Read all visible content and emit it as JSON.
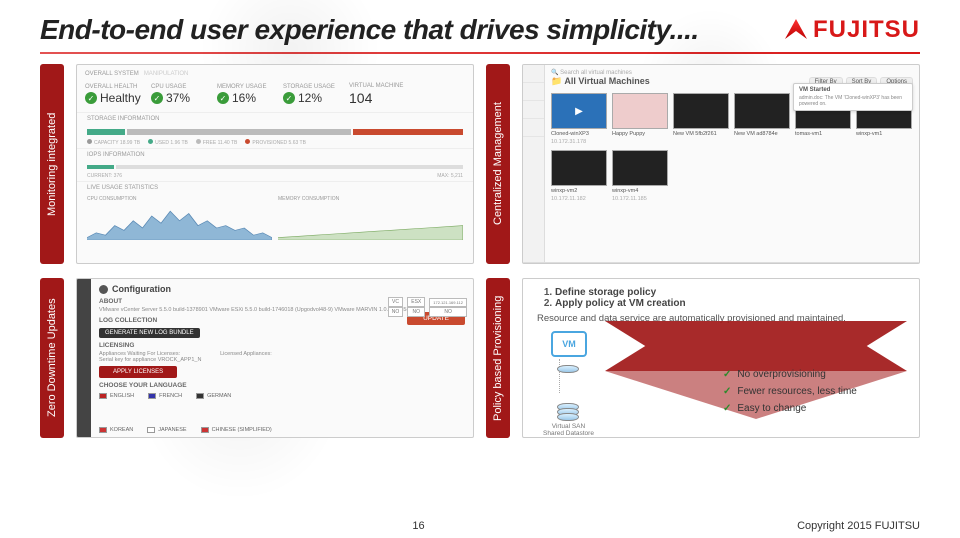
{
  "header": {
    "title": "End-to-end user experience that drives simplicity....",
    "logo_text": "FUJITSU"
  },
  "tabs": {
    "monitoring": "Monitoring integrated",
    "centralized": "Centralized Management",
    "zero_downtime": "Zero Downtime Updates",
    "policy": "Policy based Provisioning"
  },
  "monitoring": {
    "section1": "OVERALL SYSTEM",
    "section1b": "MANIPULATION",
    "health_k": "OVERALL HEALTH",
    "health_v": "Healthy",
    "cpu_k": "CPU USAGE",
    "cpu_v": "37%",
    "mem_k": "MEMORY USAGE",
    "mem_v": "16%",
    "stor_k": "STORAGE USAGE",
    "stor_v": "12%",
    "vm_k": "VIRTUAL MACHINE",
    "vm_v": "104",
    "s_storage": "STORAGE INFORMATION",
    "cap_lbl": "CAPACITY 18.99 TB",
    "used_lbl": "USED 1.96 TB",
    "free_lbl": "FREE 11.40 TB",
    "prov_lbl": "PROVISIONED 5.63 TB",
    "s_iops": "IOPS INFORMATION",
    "current_lbl": "CURRENT: 376",
    "max_lbl": "MAX: 5,211",
    "s_live": "LIVE USAGE STATISTICS",
    "chart1": "CPU CONSUMPTION",
    "chart2": "MEMORY CONSUMPTION"
  },
  "centralized": {
    "search_placeholder": "Search all virtual machines",
    "crumb": "All Virtual Machines",
    "filter": "Filter By",
    "sort": "Sort By",
    "opt": "Options",
    "popup_title": "VM Started",
    "popup_line": "admin.doc: The VM 'Cloned-winXP3' has been powered on.",
    "thumbs": [
      {
        "name": "Cloned-winXP3",
        "sub": "10.172.31.178"
      },
      {
        "name": "Happy Puppy",
        "sub": ""
      },
      {
        "name": "New VM 5fb2f261",
        "sub": ""
      },
      {
        "name": "New VM ad8784e",
        "sub": ""
      },
      {
        "name": "tomas-vm1",
        "sub": ""
      },
      {
        "name": "winxp-vm1",
        "sub": ""
      },
      {
        "name": "winxp-vm2",
        "sub": "10.172.11.182"
      },
      {
        "name": "winxp-vm4",
        "sub": "10.172.11.185"
      }
    ]
  },
  "zero_downtime": {
    "config": "Configuration",
    "about": "ABOUT",
    "ver_line": "VMware vCenter Server 5.5.0 build-1378901       VMware ESXi 5.5.0 build-1746018 (Upgodvol48-9)       VMware MARVIN 1.0.0.a 1358262",
    "vc": "VC",
    "esx": "ESX",
    "ip": "172.121.169.112",
    "no": "NO",
    "log": "LOG COLLECTION",
    "gen": "GENERATE NEW LOG BUNDLE",
    "update": "UPDATE",
    "lic": "LICENSING",
    "lic1": "Appliances Waiting For Licenses:",
    "lic2": "Licensed Appliances:",
    "serial": "Serial key for appliance VROCK_APP1_N",
    "apply": "APPLY LICENSES",
    "lang_h": "CHOOSE YOUR LANGUAGE",
    "langs": [
      "ENGLISH",
      "FRENCH",
      "GERMAN",
      "KOREAN",
      "JAPANESE",
      "CHINESE (SIMPLIFIED)"
    ]
  },
  "policy": {
    "step1": "Define storage policy",
    "step2": "Apply policy at VM creation",
    "sub": "Resource and data service are automatically provisioned and maintained.",
    "vm": "VM",
    "ds1": "Virtual SAN",
    "ds2": "Shared Datastore",
    "checks": [
      "No overprovisioning",
      "Fewer resources, less time",
      "Easy to change"
    ]
  },
  "footer": {
    "page": "16",
    "copyright": "Copyright 2015 FUJITSU"
  }
}
